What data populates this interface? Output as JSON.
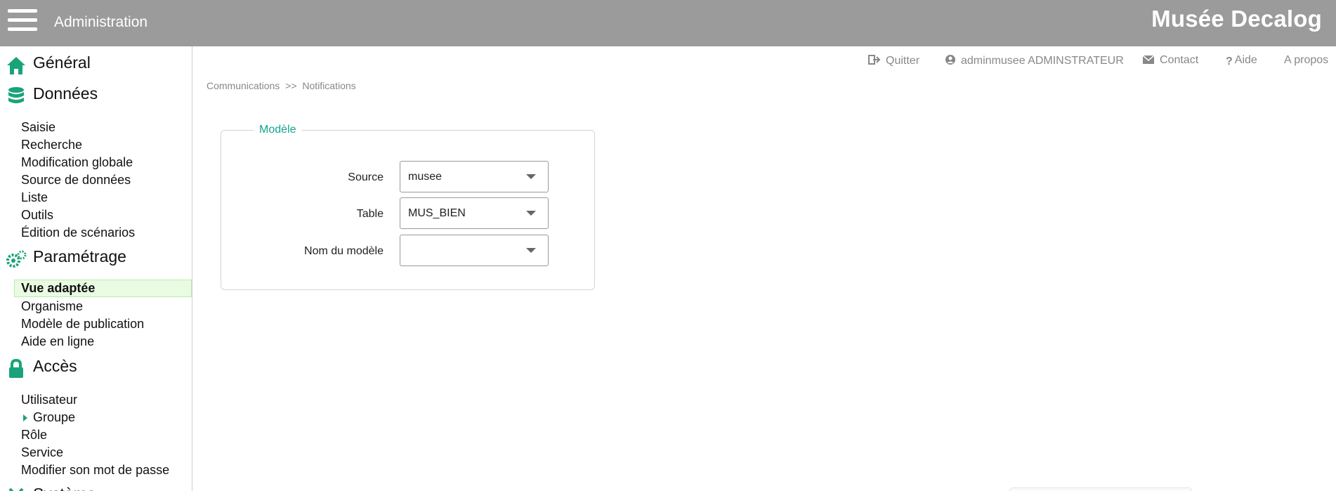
{
  "header": {
    "title": "Administration",
    "brand": "Musée Decalog"
  },
  "topnav": {
    "quit": "Quitter",
    "user": "adminmusee ADMINSTRATEUR",
    "contact": "Contact",
    "help": "Aide",
    "about": "A propos"
  },
  "breadcrumb": {
    "parent": "Communications",
    "separator": ">>",
    "current": "Notifications"
  },
  "sidebar": {
    "general": "Général",
    "donnees": {
      "title": "Données",
      "items": [
        "Saisie",
        "Recherche",
        "Modification globale",
        "Source de données",
        "Liste",
        "Outils",
        "Édition de scénarios"
      ]
    },
    "parametrage": {
      "title": "Paramétrage",
      "items": [
        "Vue adaptée",
        "Organisme",
        "Modèle de publication",
        "Aide en ligne"
      ],
      "active": "Vue adaptée"
    },
    "acces": {
      "title": "Accès",
      "items": [
        "Utilisateur",
        "Groupe",
        "Rôle",
        "Service",
        "Modifier son mot de passe"
      ]
    },
    "systeme": "Système"
  },
  "form": {
    "legend": "Modèle",
    "source_label": "Source",
    "source_value": "musee",
    "table_label": "Table",
    "table_value": "MUS_BIEN",
    "model_label": "Nom du modèle",
    "model_value": ""
  },
  "colors": {
    "topbar": "#9b9b9b",
    "accent": "#1aa37a",
    "active_bg": "#e9fbe2",
    "legend": "#12a58c"
  },
  "icons": [
    "home-icon",
    "database-icon",
    "gears-icon",
    "lock-icon",
    "tools-icon",
    "sign-out-icon",
    "user-circle-icon",
    "envelope-icon",
    "question-icon",
    "chevron-down-icon"
  ]
}
